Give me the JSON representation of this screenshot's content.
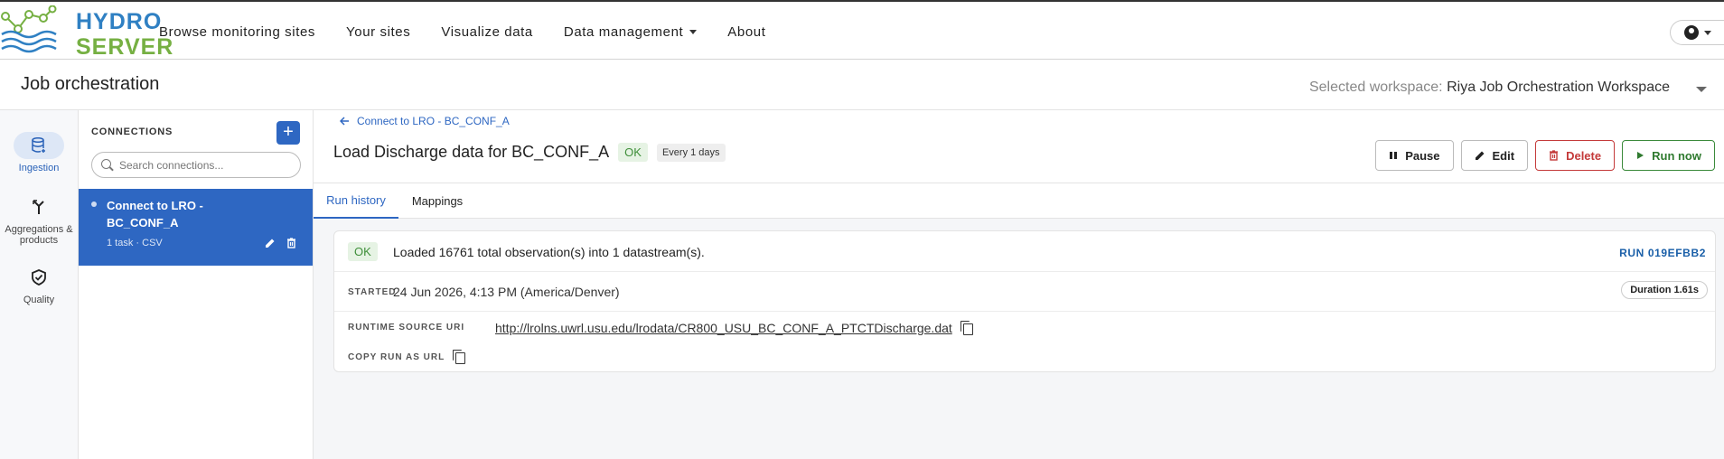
{
  "app": {
    "logo_line1": "HYDRO",
    "logo_line2": "SERVER"
  },
  "nav": {
    "items": [
      {
        "label": "Browse monitoring sites"
      },
      {
        "label": "Your sites"
      },
      {
        "label": "Visualize data"
      },
      {
        "label": "Data management"
      },
      {
        "label": "About"
      }
    ]
  },
  "page": {
    "title": "Job orchestration",
    "workspace_label": "Selected workspace:",
    "workspace_name": "Riya Job Orchestration Workspace"
  },
  "rail": {
    "items": [
      {
        "label": "Ingestion",
        "icon": "database-icon"
      },
      {
        "label": "Aggregations & products",
        "icon": "merge-icon"
      },
      {
        "label": "Quality",
        "icon": "shield-check-icon"
      }
    ]
  },
  "connections": {
    "heading": "CONNECTIONS",
    "add_label": "+",
    "search_placeholder": "Search connections...",
    "selected": {
      "name": "Connect to LRO - BC_CONF_A",
      "meta": "1 task · CSV"
    }
  },
  "job": {
    "back_label": "Connect to LRO - BC_CONF_A",
    "title": "Load Discharge data for BC_CONF_A",
    "status": "OK",
    "schedule": "Every 1 days",
    "buttons": {
      "pause": "Pause",
      "edit": "Edit",
      "delete": "Delete",
      "run_now": "Run now"
    }
  },
  "tabs": {
    "run_history": "Run history",
    "mappings": "Mappings"
  },
  "run": {
    "status": "OK",
    "message": "Loaded 16761 total observation(s) into 1 datastream(s).",
    "run_id": "RUN 019EFBB2",
    "started_label": "STARTED",
    "started_value": "24 Jun 2026, 4:13 PM (America/Denver)",
    "duration": "Duration 1.61s",
    "runtime_source_label": "RUNTIME SOURCE URI",
    "runtime_source_uri": "http://lrolns.uwrl.usu.edu/lrodata/CR800_USU_BC_CONF_A_PTCTDischarge.dat",
    "copy_run_label": "COPY RUN AS URL"
  },
  "colors": {
    "primary": "#2e67c2",
    "ok_green": "#3f8f3a",
    "delete_red": "#c43a3a",
    "logo_blue": "#2f80c3",
    "logo_green": "#76b043"
  }
}
